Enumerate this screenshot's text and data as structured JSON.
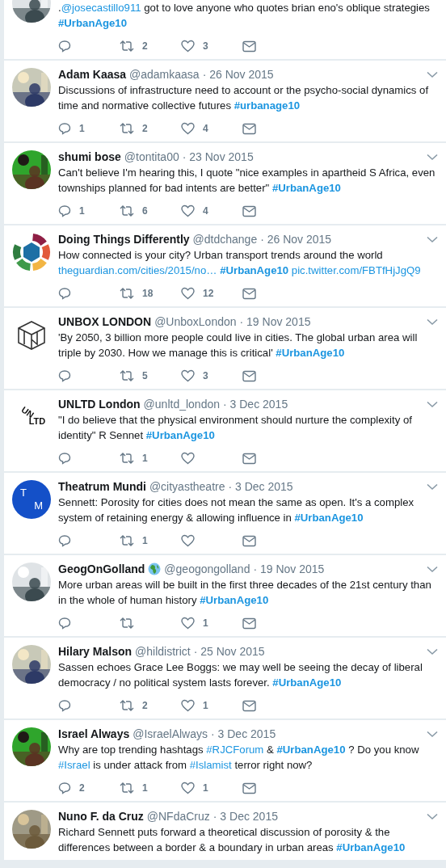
{
  "tweets": [
    {
      "body": [
        {
          "kind": "text",
          "text": "."
        },
        {
          "kind": "link",
          "text": "@josecastillo911"
        },
        {
          "kind": "text",
          "text": " got to love anyone who quotes brian eno's oblique strategies "
        },
        {
          "kind": "hashtag",
          "text": "#UrbanAge10"
        }
      ],
      "retweets": "2",
      "likes": "3"
    },
    {
      "name": "Adam Kaasa",
      "handle": "@adamkaasa",
      "date": "· 26 Nov 2015",
      "body": [
        {
          "kind": "text",
          "text": "Discussions of infrastructure need to account or the psycho-social dynamics of time and normative collective futures  "
        },
        {
          "kind": "hashtag",
          "text": "#urbanage10"
        }
      ],
      "replies": "1",
      "retweets": "2",
      "likes": "4"
    },
    {
      "name": "shumi bose",
      "handle": "@tontita00",
      "date": "· 23 Nov 2015",
      "body": [
        {
          "kind": "text",
          "text": "Can't believe I'm hearing this, I quote \"nice examples in apartheid S Africa, even townships planned for bad intents are better\" "
        },
        {
          "kind": "hashtag",
          "text": "#UrbanAge10"
        }
      ],
      "replies": "1",
      "retweets": "6",
      "likes": "4"
    },
    {
      "name": "Doing Things Differently",
      "handle": "@dtdchange",
      "date": "· 26 Nov 2015",
      "avatar": {
        "kind": "wheel"
      },
      "body": [
        {
          "kind": "text",
          "text": "How connected is your city? Urban transport trends around the world "
        },
        {
          "kind": "link",
          "text": "theguardian.com/cities/2015/no…"
        },
        {
          "kind": "hashtag",
          "text": "#UrbanAge10"
        },
        {
          "kind": "link",
          "text": "pic.twitter.com/FBTfHjJgQ9"
        }
      ],
      "retweets": "18",
      "likes": "12"
    },
    {
      "name": "UNBOX LONDON",
      "handle": "@UnboxLondon",
      "date": "· 19 Nov 2015",
      "avatar": {
        "kind": "cube"
      },
      "body": [
        {
          "kind": "text",
          "text": "'By 2050, 3 billion more people could live in cities. The global urban area will triple by 2030. How we manage this is critical' "
        },
        {
          "kind": "hashtag",
          "text": "#UrbanAge10"
        }
      ],
      "retweets": "5",
      "likes": "3"
    },
    {
      "name": "UNLTD London",
      "handle": "@unltd_london",
      "date": "· 3 Dec 2015",
      "avatar": {
        "kind": "wordmark",
        "letters": [
          "UN",
          "LTD"
        ]
      },
      "body": [
        {
          "kind": "text",
          "text": "\"I do believe that the physical environment should nurture the complexity of identity\" R Sennet "
        },
        {
          "kind": "hashtag",
          "text": "#UrbanAge10"
        }
      ],
      "retweets": "1"
    },
    {
      "name": "Theatrum Mundi",
      "handle": "@cityastheatre",
      "date": "· 3 Dec 2015",
      "avatar": {
        "kind": "initials",
        "letters": [
          "T",
          "M"
        ]
      },
      "body": [
        {
          "kind": "text",
          "text": "Sennett: Porosity for cities does not mean the same as open. It's a complex system of retaining energy & allowing influence in "
        },
        {
          "kind": "hashtag",
          "text": "#UrbanAge10"
        }
      ],
      "retweets": "1"
    },
    {
      "name": "GeogOnGolland",
      "globe_badge": true,
      "handle": "@geogongolland",
      "date": "· 19 Nov 2015",
      "body": [
        {
          "kind": "text",
          "text": "More urban areas will be built in the first three decades of the 21st century than in the whole of human history "
        },
        {
          "kind": "hashtag",
          "text": "#UrbanAge10"
        }
      ],
      "likes": "1"
    },
    {
      "name": "Hilary Malson",
      "handle": "@hildistrict",
      "date": "· 25 Nov 2015",
      "body": [
        {
          "kind": "text",
          "text": "Sassen echoes Grace Lee Boggs: we may well be seeing the decay of liberal democracy / no political system lasts forever. "
        },
        {
          "kind": "hashtag",
          "text": "#UrbanAge10"
        }
      ],
      "retweets": "2",
      "likes": "1"
    },
    {
      "name": "Israel Always",
      "handle": "@IsraelAlways",
      "date": "· 3 Dec 2015",
      "body": [
        {
          "kind": "text",
          "text": "Why are top trending hashtags  "
        },
        {
          "kind": "link",
          "text": "#RJCForum"
        },
        {
          "kind": "text",
          "text": " &     "
        },
        {
          "kind": "hashtag",
          "text": "#UrbanAge10"
        },
        {
          "kind": "text",
          "text": " ? Do you know "
        },
        {
          "kind": "link",
          "text": "#Israel"
        },
        {
          "kind": "text",
          "text": " is under attack from "
        },
        {
          "kind": "link",
          "text": "#Islamist"
        },
        {
          "kind": "text",
          "text": " terror right now?"
        }
      ],
      "replies": "2",
      "retweets": "1",
      "likes": "1"
    },
    {
      "name": "Nuno F. da Cruz",
      "handle": "@NFdaCruz",
      "date": "· 3 Dec 2015",
      "body": [
        {
          "kind": "text",
          "text": "Richard Sennett puts forward a theoretical discussion of porosity & the differences between a border & a boundary in urban areas "
        },
        {
          "kind": "hashtag",
          "text": "#UrbanAge10"
        }
      ]
    }
  ]
}
